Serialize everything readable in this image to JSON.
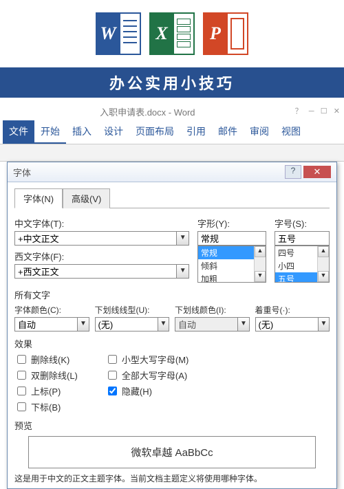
{
  "banner": {
    "title": "办公实用小技巧"
  },
  "word": {
    "doc_title": "入职申请表.docx - Word",
    "tabs": {
      "file": "文件",
      "home": "开始",
      "insert": "插入",
      "design": "设计",
      "layout": "页面布局",
      "ref": "引用",
      "mail": "邮件",
      "review": "审阅",
      "view": "视图"
    }
  },
  "dialog": {
    "title": "字体",
    "tabs": {
      "font": "字体(N)",
      "advanced": "高级(V)"
    },
    "labels": {
      "cfont": "中文字体(T):",
      "wfont": "西文字体(F):",
      "style": "字形(Y):",
      "size": "字号(S):",
      "alltext": "所有文字",
      "fcolor": "字体颜色(C):",
      "utype": "下划线线型(U):",
      "ucolor": "下划线颜色(I):",
      "emark": "着重号(·):",
      "effects": "效果",
      "preview": "预览"
    },
    "values": {
      "cfont": "+中文正文",
      "wfont": "+西文正文",
      "style": "常规",
      "size": "五号",
      "fcolor": "自动",
      "utype": "(无)",
      "ucolor": "自动",
      "emark": "(无)"
    },
    "styleList": [
      "常规",
      "倾斜",
      "加粗"
    ],
    "sizeList": [
      "四号",
      "小四",
      "五号"
    ],
    "effects": {
      "strike": "删除线(K)",
      "dstrike": "双删除线(L)",
      "sup": "上标(P)",
      "sub": "下标(B)",
      "smallcaps": "小型大写字母(M)",
      "allcaps": "全部大写字母(A)",
      "hidden": "隐藏(H)"
    },
    "preview_text": "微软卓越 AaBbCc",
    "footnote": "这是用于中文的正文主题字体。当前文档主题定义将使用哪种字体。"
  }
}
